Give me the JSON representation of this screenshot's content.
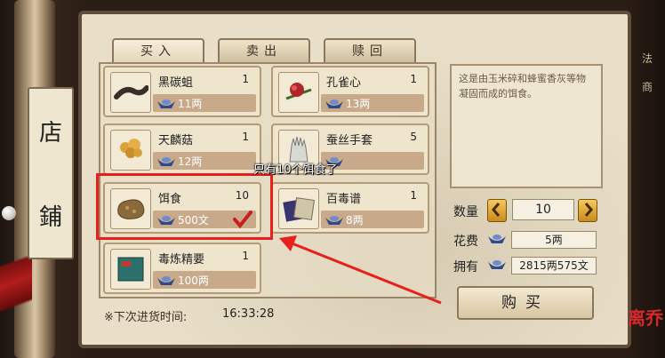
{
  "side": {
    "shop_label_top": "店",
    "shop_label_bottom": "鋪"
  },
  "tabs": [
    {
      "label": "买入",
      "active": true
    },
    {
      "label": "卖出",
      "active": false
    },
    {
      "label": "赎回",
      "active": false
    }
  ],
  "items": [
    {
      "name": "黑碳蛆",
      "qty": "1",
      "price": "11两",
      "icon": "black-worm-icon"
    },
    {
      "name": "孔雀心",
      "qty": "1",
      "price": "13两",
      "icon": "peacock-heart-icon"
    },
    {
      "name": "天麟菇",
      "qty": "1",
      "price": "12两",
      "icon": "mushroom-icon"
    },
    {
      "name": "蚕丝手套",
      "qty": "5",
      "price": "",
      "icon": "silk-glove-icon"
    },
    {
      "name": "饵食",
      "qty": "10",
      "price": "500文",
      "icon": "bait-icon",
      "selected": true
    },
    {
      "name": "百毒谱",
      "qty": "1",
      "price": "8两",
      "icon": "poison-book-icon"
    },
    {
      "name": "毒炼精要",
      "qty": "1",
      "price": "100两",
      "icon": "poison-manual-icon"
    }
  ],
  "annotation": {
    "tooltip": "只有10个饵食了",
    "highlight_color": "#e8201c"
  },
  "restock": {
    "label": "※下次进货时间:",
    "time": "16:33:28"
  },
  "detail": {
    "description": "这是由玉米碎和蜂蜜香灰等物凝固而成的饵食。",
    "quantity_label": "数量",
    "quantity_value": "10",
    "cost_label": "花费",
    "cost_value": "5两",
    "owned_label": "拥有",
    "owned_value": "2815两575文",
    "buy_label": "购买"
  },
  "logo_text": "离乔",
  "right_edge_text": [
    "法",
    "商"
  ]
}
